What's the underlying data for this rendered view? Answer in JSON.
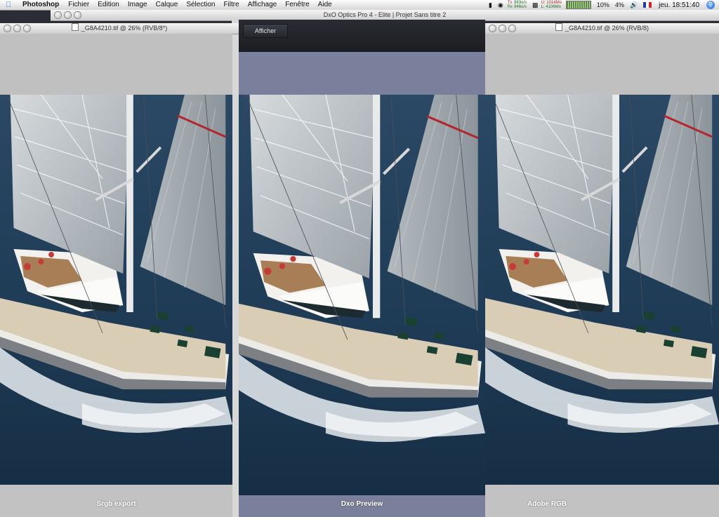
{
  "menubar": {
    "app_name": "Photoshop",
    "items": [
      "Fichier",
      "Edition",
      "Image",
      "Calque",
      "Sélection",
      "Filtre",
      "Affichage",
      "Fenêtre",
      "Aide"
    ],
    "network": {
      "tx_label": "Tx",
      "rx_label": "Rx",
      "tx_value": "983o/s",
      "rx_value": "946o/s"
    },
    "memory": {
      "used": "U: 1014Mo",
      "free": "L: 4106Mo"
    },
    "cpu_percent_1": "10%",
    "cpu_percent_2": "4%",
    "clock": "jeu. 18:51:40"
  },
  "dxo_window": {
    "title": "DxO Optics Pro 4 - Elite | Projet Sans titre 2",
    "afficher_button": "Afficher",
    "preview_label": "Dxo Preview"
  },
  "left_window": {
    "title": "_G8A4210.tif @ 26% (RVB/8*)",
    "label": "Srgb export"
  },
  "right_window": {
    "title": "_G8A4210.tif @ 26% (RVB/8)",
    "label": "Adobe RGB"
  },
  "colors": {
    "sea": "#1d3a55",
    "dxo_band": "#7a7f9b",
    "deck": "#d9cdb6"
  }
}
